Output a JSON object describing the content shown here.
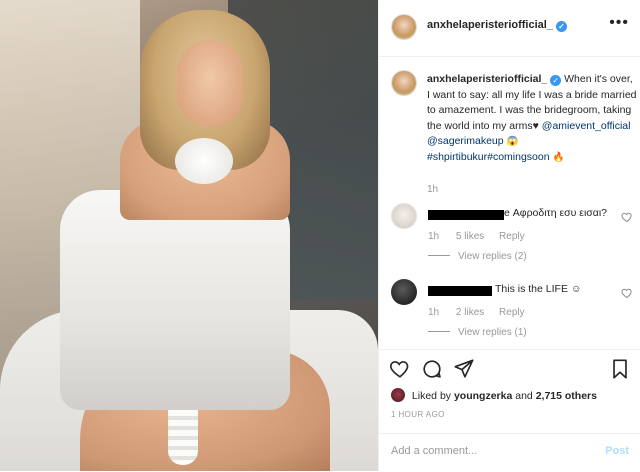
{
  "post": {
    "image_alt": "Bride in white off-shoulder lace dress",
    "author": {
      "username": "anxhelaperisteriofficial_",
      "verified": true
    },
    "caption": {
      "body": "When it's over, I want to say: all my life I was a bride married to amazement. I was the bridegroom, taking the world into my arms",
      "heart_glyph": "♥",
      "mention_1": "@amievent_official",
      "mention_2": "@sagerimakeup",
      "emoji_1": "😱",
      "hashtags": "#shpirtibukur#comingsoon",
      "emoji_2": "🔥",
      "time": "1h"
    },
    "comments": [
      {
        "text": "е Αφροδιτη εσυ εισαι?",
        "time": "1h",
        "likes": "5 likes",
        "reply": "Reply",
        "views": "View replies (2)"
      },
      {
        "text": "This is the LIFE ☺",
        "time": "1h",
        "likes": "2 likes",
        "reply": "Reply",
        "views": "View replies (1)"
      }
    ],
    "liked_by": {
      "prefix": "Liked by",
      "user": "youngzerka",
      "joiner": "and",
      "others": "2,715 others"
    },
    "timestamp": "1 HOUR AGO",
    "add_comment": {
      "placeholder": "Add a comment...",
      "post_label": "Post"
    }
  },
  "icons": {
    "more": "more-options-icon",
    "like": "heart-icon",
    "comment": "comment-icon",
    "share": "share-icon",
    "save": "bookmark-icon"
  },
  "colors": {
    "verified": "#3897f0",
    "link": "#003569",
    "muted": "#999999",
    "post_button_disabled": "#b2dffc"
  }
}
